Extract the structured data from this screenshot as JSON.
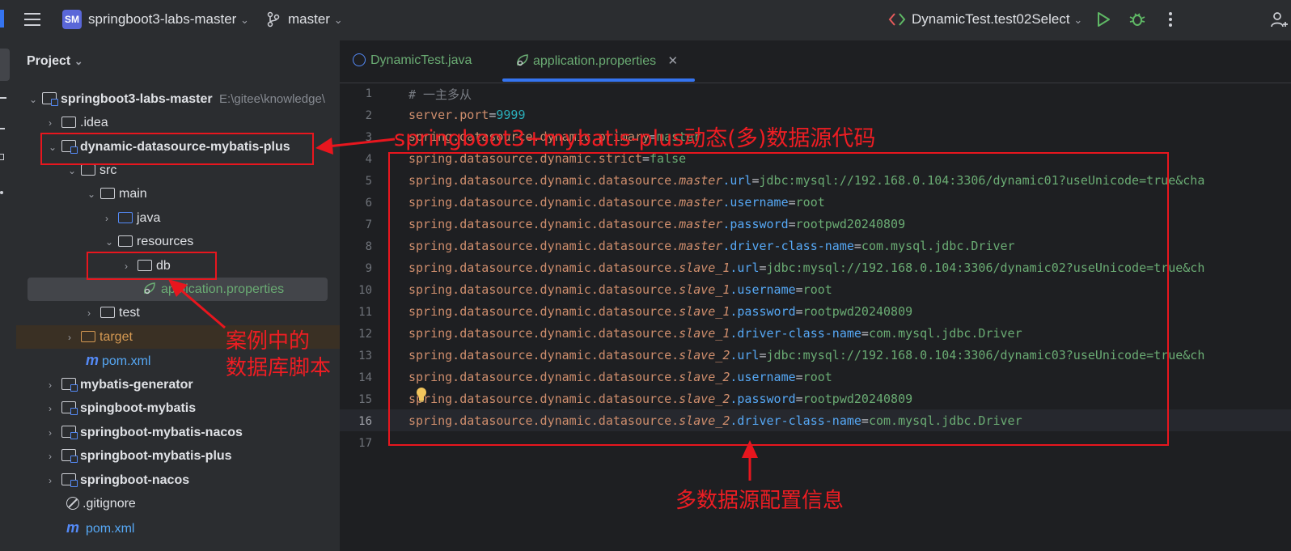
{
  "toolbar": {
    "project_badge": "SM",
    "project_name": "springboot3-labs-master",
    "branch": "master",
    "run_config": "DynamicTest.test02Select"
  },
  "project_panel": {
    "title": "Project",
    "tree": [
      {
        "label": "springboot3-labs-master",
        "path": "E:\\gitee\\knowledge\\"
      },
      {
        "label": ".idea"
      },
      {
        "label": "dynamic-datasource-mybatis-plus"
      },
      {
        "label": "src"
      },
      {
        "label": "main"
      },
      {
        "label": "java"
      },
      {
        "label": "resources"
      },
      {
        "label": "db"
      },
      {
        "label": "application.properties"
      },
      {
        "label": "test"
      },
      {
        "label": "target"
      },
      {
        "label": "pom.xml"
      },
      {
        "label": "mybatis-generator"
      },
      {
        "label": "spingboot-mybatis"
      },
      {
        "label": "springboot-mybatis-nacos"
      },
      {
        "label": "springboot-mybatis-plus"
      },
      {
        "label": "springboot-nacos"
      },
      {
        "label": ".gitignore"
      },
      {
        "label": "pom.xml"
      }
    ]
  },
  "tabs": [
    {
      "label": "DynamicTest.java"
    },
    {
      "label": "application.properties"
    }
  ],
  "code": {
    "line_numbers": [
      "1",
      "2",
      "3",
      "4",
      "5",
      "6",
      "7",
      "8",
      "9",
      "10",
      "11",
      "12",
      "13",
      "14",
      "15",
      "16",
      "17"
    ],
    "lines": [
      {
        "a": "# 一主多从"
      },
      {
        "a": "server.port",
        "eq": "=",
        "v": "9999"
      },
      {
        "a": "spring.datasource.dynamic.primary",
        "eq": "=",
        "v": "master"
      },
      {
        "a": "spring.datasource.dynamic.strict",
        "eq": "=",
        "v": "false"
      },
      {
        "a": "spring.datasource.dynamic.datasource.",
        "i": "master",
        "b": ".url",
        "eq": "=",
        "v": "jdbc:mysql://192.168.0.104:3306/dynamic01?useUnicode=true&cha"
      },
      {
        "a": "spring.datasource.dynamic.datasource.",
        "i": "master",
        "b": ".username",
        "eq": "=",
        "v": "root"
      },
      {
        "a": "spring.datasource.dynamic.datasource.",
        "i": "master",
        "b": ".password",
        "eq": "=",
        "v": "rootpwd20240809"
      },
      {
        "a": "spring.datasource.dynamic.datasource.",
        "i": "master",
        "b": ".driver-class-name",
        "eq": "=",
        "v": "com.mysql.jdbc.Driver"
      },
      {
        "a": "spring.datasource.dynamic.datasource.",
        "i": "slave_1",
        "b": ".url",
        "eq": "=",
        "v": "jdbc:mysql://192.168.0.104:3306/dynamic02?useUnicode=true&ch"
      },
      {
        "a": "spring.datasource.dynamic.datasource.",
        "i": "slave_1",
        "b": ".username",
        "eq": "=",
        "v": "root"
      },
      {
        "a": "spring.datasource.dynamic.datasource.",
        "i": "slave_1",
        "b": ".password",
        "eq": "=",
        "v": "rootpwd20240809"
      },
      {
        "a": "spring.datasource.dynamic.datasource.",
        "i": "slave_1",
        "b": ".driver-class-name",
        "eq": "=",
        "v": "com.mysql.jdbc.Driver"
      },
      {
        "a": "spring.datasource.dynamic.datasource.",
        "i": "slave_2",
        "b": ".url",
        "eq": "=",
        "v": "jdbc:mysql://192.168.0.104:3306/dynamic03?useUnicode=true&ch"
      },
      {
        "a": "spring.datasource.dynamic.datasource.",
        "i": "slave_2",
        "b": ".username",
        "eq": "=",
        "v": "root"
      },
      {
        "a": "spring.datasource.dynamic.datasource.",
        "i": "slave_2",
        "b": ".password",
        "eq": "=",
        "v": "rootpwd20240809"
      },
      {
        "a": "spring.datasource.dynamic.datasource.",
        "i": "slave_2",
        "b": ".driver-class-name",
        "eq": "=",
        "v": "com.mysql.jdbc.Driver"
      }
    ]
  },
  "annotations": {
    "module_note": "springboot3+mybatis-plus动态(多)数据源代码",
    "db_note_line1": "案例中的",
    "db_note_line2": "数据库脚本",
    "config_note": "多数据源配置信息"
  },
  "colors": {
    "annotation_red": "#e8161e",
    "accent_blue": "#3574f0"
  }
}
